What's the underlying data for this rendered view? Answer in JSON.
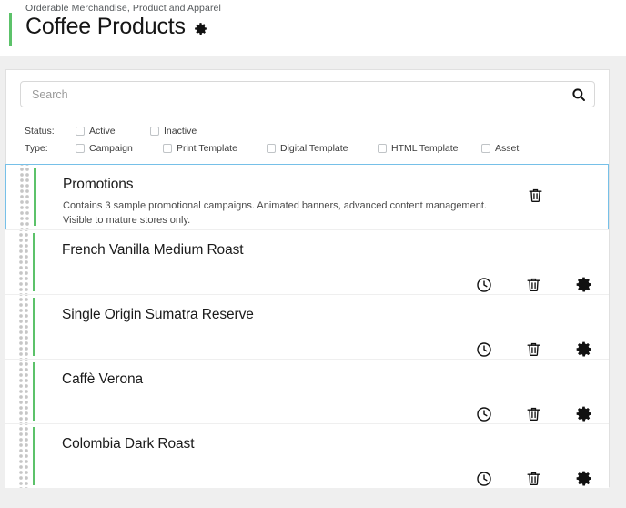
{
  "header": {
    "breadcrumb": "Orderable Merchandise, Product and Apparel",
    "title": "Coffee Products",
    "gear_icon": "gear-icon",
    "accent_color": "#5cc26a"
  },
  "search": {
    "placeholder": "Search",
    "value": "",
    "icon": "search-icon"
  },
  "filters": {
    "status": {
      "label": "Status:",
      "options": [
        {
          "label": "Active",
          "checked": false
        },
        {
          "label": "Inactive",
          "checked": false
        }
      ]
    },
    "type": {
      "label": "Type:",
      "options": [
        {
          "label": "Campaign",
          "checked": false
        },
        {
          "label": "Print Template",
          "checked": false
        },
        {
          "label": "Digital Template",
          "checked": false
        },
        {
          "label": "HTML Template",
          "checked": false
        },
        {
          "label": "Asset",
          "checked": false
        }
      ]
    }
  },
  "list": {
    "selected_border_color": "#76c0e8",
    "items": [
      {
        "title": "Promotions",
        "description_line1": "Contains 3 sample promotional campaigns. Animated banners, advanced content management.",
        "description_line2": "Visible to mature stores only.",
        "selected": true,
        "actions": [
          "delete-icon"
        ]
      },
      {
        "title": "French Vanilla Medium Roast",
        "selected": false,
        "actions": [
          "history-icon",
          "delete-icon",
          "settings-icon"
        ]
      },
      {
        "title": "Single Origin Sumatra Reserve",
        "selected": false,
        "actions": [
          "history-icon",
          "delete-icon",
          "settings-icon"
        ]
      },
      {
        "title": "Caffè Verona",
        "selected": false,
        "actions": [
          "history-icon",
          "delete-icon",
          "settings-icon"
        ]
      },
      {
        "title": "Colombia Dark Roast",
        "selected": false,
        "actions": [
          "history-icon",
          "delete-icon",
          "settings-icon"
        ]
      }
    ]
  }
}
